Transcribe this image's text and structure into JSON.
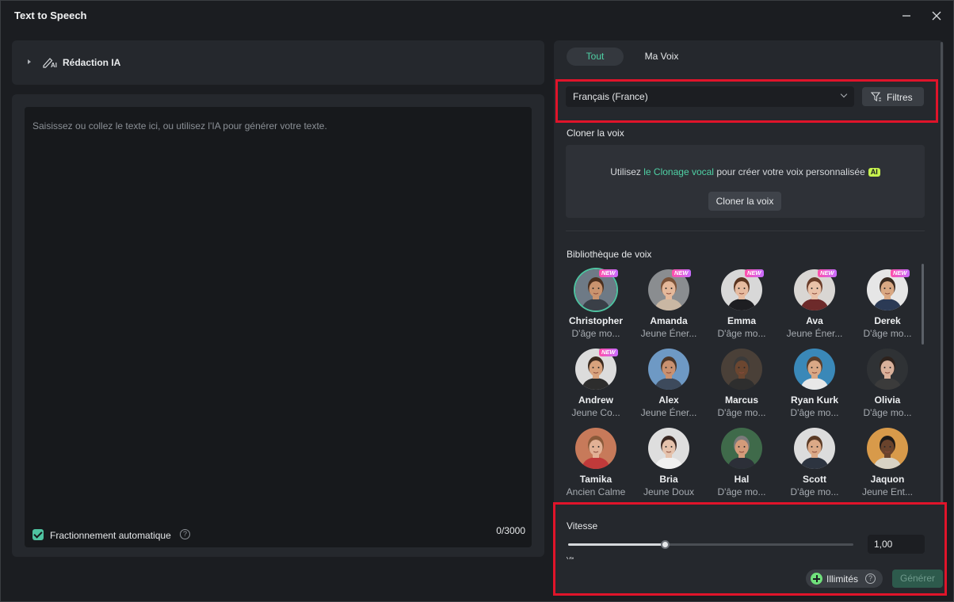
{
  "window": {
    "title": "Text to Speech"
  },
  "ai_writing": {
    "label": "Rédaction IA"
  },
  "editor": {
    "placeholder": "Saisissez ou collez le texte ici, ou utilisez l'IA pour générer votre texte.",
    "auto_split_label": "Fractionnement automatique",
    "auto_split_checked": true,
    "char_count": "0/3000"
  },
  "tabs": [
    {
      "label": "Tout",
      "active": true
    },
    {
      "label": "Ma Voix",
      "active": false
    }
  ],
  "language": {
    "selected": "Français (France)"
  },
  "filters": {
    "label": "Filtres"
  },
  "clone": {
    "title": "Cloner la voix",
    "text_before": "Utilisez",
    "link": "le Clonage vocal",
    "text_after": "pour créer votre voix personnalisée",
    "badge": "AI",
    "button": "Cloner la voix"
  },
  "library": {
    "title": "Bibliothèque de voix",
    "new_badge": "NEW",
    "voices": [
      {
        "name": "Christopher",
        "desc": "D'âge mo...",
        "is_new": true,
        "selected": true,
        "skin": "#c9936e",
        "hair": "#4a2f1e",
        "bg": "#6e7a86",
        "shirt": "#3a3f47"
      },
      {
        "name": "Amanda",
        "desc": "Jeune Éner...",
        "is_new": true,
        "selected": false,
        "skin": "#e4b89a",
        "hair": "#7a5238",
        "bg": "#8a8d90",
        "shirt": "#c9b7a3"
      },
      {
        "name": "Emma",
        "desc": "D'âge mo...",
        "is_new": true,
        "selected": false,
        "skin": "#e6bba0",
        "hair": "#5a3520",
        "bg": "#d8d8d8",
        "shirt": "#1e1e22"
      },
      {
        "name": "Ava",
        "desc": "Jeune Éner...",
        "is_new": true,
        "selected": false,
        "skin": "#e9c1a8",
        "hair": "#6a3d2a",
        "bg": "#d9d6d3",
        "shirt": "#6d2a2a"
      },
      {
        "name": "Derek",
        "desc": "D'âge mo...",
        "is_new": true,
        "selected": false,
        "skin": "#d9a883",
        "hair": "#3a2a20",
        "bg": "#e6e6e6",
        "shirt": "#2b3a55"
      },
      {
        "name": "Andrew",
        "desc": "Jeune Co...",
        "is_new": true,
        "selected": false,
        "skin": "#d7a27d",
        "hair": "#3b2a1f",
        "bg": "#dcdcdc",
        "shirt": "#2d2d2d"
      },
      {
        "name": "Alex",
        "desc": "Jeune Éner...",
        "is_new": false,
        "selected": false,
        "skin": "#c99170",
        "hair": "#4b3628",
        "bg": "#6e99c4",
        "shirt": "#3d4a5c"
      },
      {
        "name": "Marcus",
        "desc": "D'âge mo...",
        "is_new": false,
        "selected": false,
        "skin": "#6b4630",
        "hair": "#3a3a3a",
        "bg": "#4a4038",
        "shirt": "#2e2e2e"
      },
      {
        "name": "Ryan Kurk",
        "desc": "D'âge mo...",
        "is_new": false,
        "selected": false,
        "skin": "#d9a886",
        "hair": "#5a3d2a",
        "bg": "#3a88b8",
        "shirt": "#e8e8e8"
      },
      {
        "name": "Olivia",
        "desc": "D'âge mo...",
        "is_new": false,
        "selected": false,
        "skin": "#d9b09a",
        "hair": "#2e221c",
        "bg": "#2f3235",
        "shirt": "#3b3b3b"
      },
      {
        "name": "Tamika",
        "desc": "Ancien Calme",
        "is_new": false,
        "selected": false,
        "skin": "#e2b195",
        "hair": "#8a5a3a",
        "bg": "#c77a5a",
        "shirt": "#c03a3a"
      },
      {
        "name": "Bria",
        "desc": "Jeune Doux",
        "is_new": false,
        "selected": false,
        "skin": "#e5c2ac",
        "hair": "#3a2822",
        "bg": "#dedede",
        "shirt": "#f0f0f0"
      },
      {
        "name": "Hal",
        "desc": "D'âge mo...",
        "is_new": false,
        "selected": false,
        "skin": "#d49b7a",
        "hair": "#7a7a7a",
        "bg": "#3f6a4a",
        "shirt": "#2c2f38"
      },
      {
        "name": "Scott",
        "desc": "D'âge mo...",
        "is_new": false,
        "selected": false,
        "skin": "#dba987",
        "hair": "#5a3a25",
        "bg": "#dcdcdc",
        "shirt": "#2d3440"
      },
      {
        "name": "Jaquon",
        "desc": "Jeune Ent...",
        "is_new": false,
        "selected": false,
        "skin": "#6a432c",
        "hair": "#1e1a18",
        "bg": "#d89a4a",
        "shirt": "#d8d2c4"
      }
    ]
  },
  "speed": {
    "label": "Vitesse",
    "value": "1,00",
    "fraction": 0.34,
    "next_label_partial": "Vit"
  },
  "footer": {
    "unlimited_label": "Illimités",
    "generate_label": "Générer"
  },
  "colors": {
    "accent": "#4fd1a5",
    "highlight": "#e0142a",
    "new_badge": "#ff4fa8"
  }
}
